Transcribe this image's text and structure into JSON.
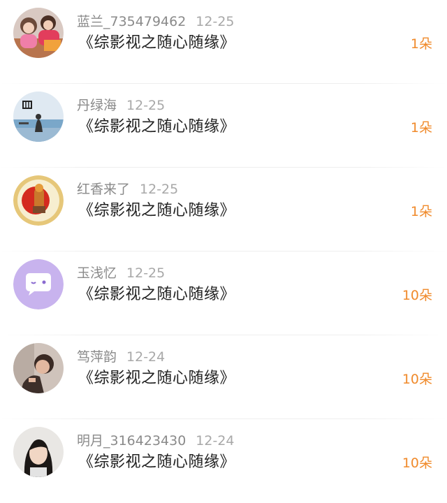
{
  "gifts": [
    {
      "user": "蓝兰_735479462",
      "date": "12-25",
      "book": "《综影视之随心随缘》",
      "count": "1朵",
      "avatar_icon": "kids-photo-avatar-icon"
    },
    {
      "user": "丹绿海",
      "date": "12-25",
      "book": "《综影视之随心随缘》",
      "count": "1朵",
      "avatar_icon": "seaside-photo-avatar-icon"
    },
    {
      "user": "红香来了",
      "date": "12-25",
      "book": "《综影视之随心随缘》",
      "count": "1朵",
      "avatar_icon": "emblem-avatar-icon"
    },
    {
      "user": "玉浅忆",
      "date": "12-25",
      "book": "《综影视之随心随缘》",
      "count": "10朵",
      "avatar_icon": "chat-bubble-avatar-icon"
    },
    {
      "user": "笃萍韵",
      "date": "12-24",
      "book": "《综影视之随心随缘》",
      "count": "10朵",
      "avatar_icon": "portrait-photo-avatar-icon"
    },
    {
      "user": "明月_316423430",
      "date": "12-24",
      "book": "《综影视之随心随缘》",
      "count": "10朵",
      "avatar_icon": "girl-photo-avatar-icon"
    }
  ],
  "colors": {
    "count": "#f08a2b",
    "username": "#8a8a8a",
    "title": "#222222",
    "bubble_avatar_bg": "#c8b3ee"
  }
}
